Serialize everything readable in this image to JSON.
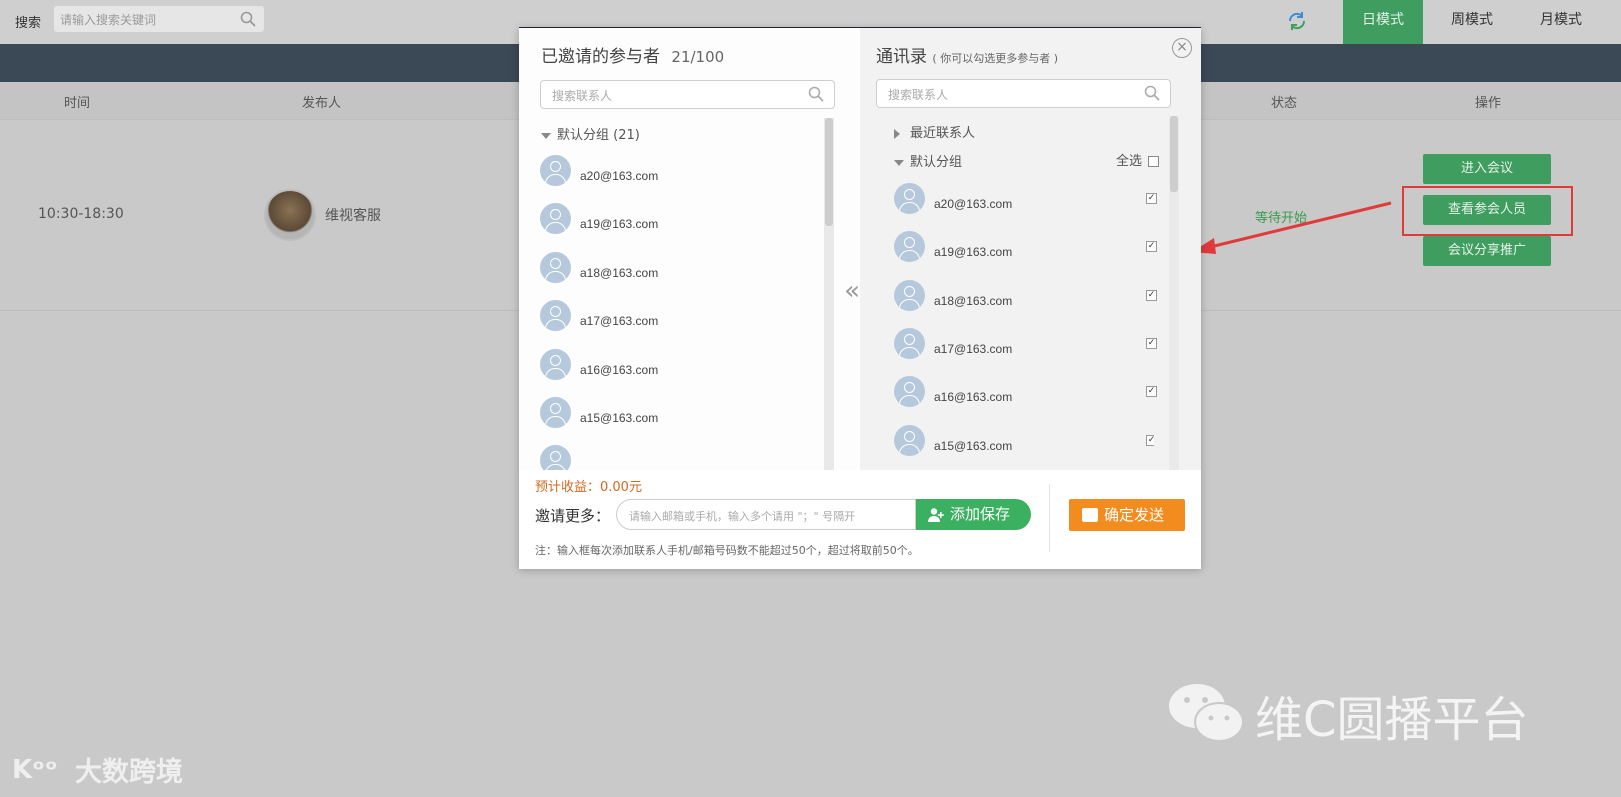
{
  "topbar": {
    "search_label": "搜索",
    "search_placeholder": "请输入搜索关键词",
    "modes": [
      "日模式",
      "周模式",
      "月模式"
    ],
    "active_mode": "日模式"
  },
  "columns": [
    "时间",
    "发布人",
    "状态",
    "操作"
  ],
  "meeting": {
    "time": "10:30-18:30",
    "publisher": "维视客服",
    "status": "等待开始",
    "actions": [
      "进入会议",
      "查看参会人员",
      "会议分享推广"
    ]
  },
  "modal": {
    "left_title": "已邀请的参与者",
    "left_count": "21/100",
    "left_search_placeholder": "搜索联系人",
    "left_group": "默认分组 (21)",
    "left_contacts": [
      "a20@163.com",
      "a19@163.com",
      "a18@163.com",
      "a17@163.com",
      "a16@163.com",
      "a15@163.com"
    ],
    "right_title": "通讯录",
    "right_subtitle": "( 你可以勾选更多参与者 )",
    "right_search_placeholder": "搜索联系人",
    "recent_group": "最近联系人",
    "default_group": "默认分组",
    "select_all": "全选",
    "right_contacts": [
      "a20@163.com",
      "a19@163.com",
      "a18@163.com",
      "a17@163.com",
      "a16@163.com",
      "a15@163.com"
    ],
    "income": "预计收益：0.00元",
    "invite_label": "邀请更多：",
    "invite_placeholder": "请输入邮箱或手机，输入多个请用 \"；\" 号隔开",
    "add_save": "添加保存",
    "send": "确定发送",
    "note": "注：输入框每次添加联系人手机/邮箱号码数不能超过50个，超过将取前50个。"
  },
  "watermarks": {
    "bottom_right": "维C圆播平台",
    "bottom_left": "大数跨境"
  },
  "colors": {
    "green": "#3e9d5f",
    "orange": "#f28c1f",
    "highlight_red": "#e03a3a"
  }
}
